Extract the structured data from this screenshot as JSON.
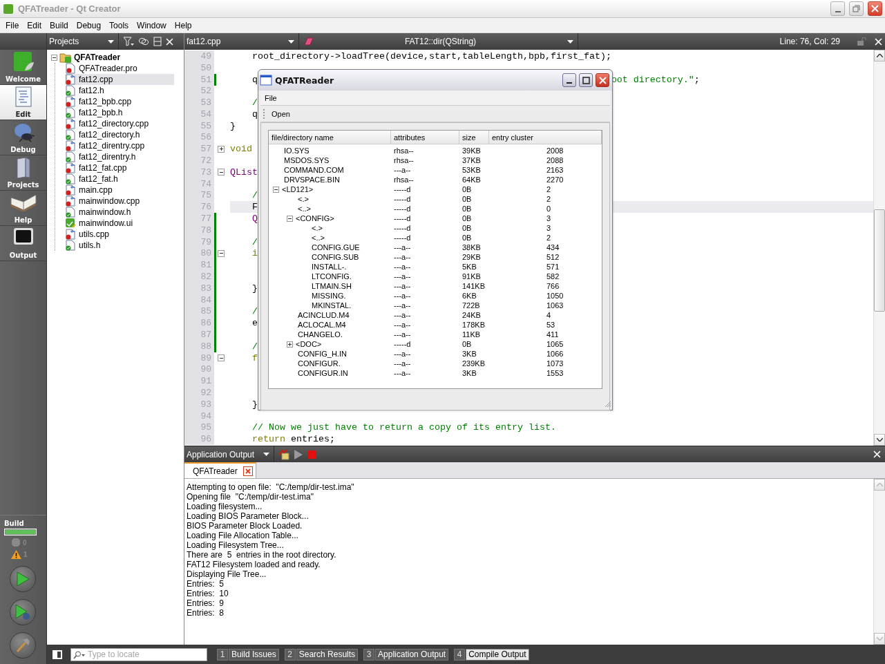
{
  "window": {
    "title": "QFATreader - Qt Creator"
  },
  "menu": [
    "File",
    "Edit",
    "Build",
    "Debug",
    "Tools",
    "Window",
    "Help"
  ],
  "modes": [
    {
      "label": "Welcome",
      "kind": "welcome",
      "selected": false
    },
    {
      "label": "Edit",
      "kind": "edit",
      "selected": true
    },
    {
      "label": "Debug",
      "kind": "debug",
      "selected": false
    },
    {
      "label": "Projects",
      "kind": "projects",
      "selected": false
    },
    {
      "label": "Help",
      "kind": "help",
      "selected": false
    },
    {
      "label": "Output",
      "kind": "output",
      "selected": false
    }
  ],
  "build": {
    "title": "Build",
    "level": 1,
    "errors": "0",
    "warnings": "1"
  },
  "projects": {
    "title": "Projects",
    "root": {
      "name": "QFATreader",
      "expanded": true,
      "children": [
        {
          "name": "QFATreader.pro",
          "kind": "pro",
          "selected": false
        },
        {
          "name": "fat12.cpp",
          "kind": "cpp",
          "selected": true
        },
        {
          "name": "fat12.h",
          "kind": "h",
          "selected": false
        },
        {
          "name": "fat12_bpb.cpp",
          "kind": "cpp",
          "selected": false
        },
        {
          "name": "fat12_bpb.h",
          "kind": "h",
          "selected": false
        },
        {
          "name": "fat12_directory.cpp",
          "kind": "cpp",
          "selected": false
        },
        {
          "name": "fat12_directory.h",
          "kind": "h",
          "selected": false
        },
        {
          "name": "fat12_direntry.cpp",
          "kind": "cpp",
          "selected": false
        },
        {
          "name": "fat12_direntry.h",
          "kind": "h",
          "selected": false
        },
        {
          "name": "fat12_fat.cpp",
          "kind": "cpp",
          "selected": false
        },
        {
          "name": "fat12_fat.h",
          "kind": "h",
          "selected": false
        },
        {
          "name": "main.cpp",
          "kind": "cpp",
          "selected": false
        },
        {
          "name": "mainwindow.cpp",
          "kind": "cpp",
          "selected": false
        },
        {
          "name": "mainwindow.h",
          "kind": "h",
          "selected": false
        },
        {
          "name": "mainwindow.ui",
          "kind": "ui",
          "selected": false
        },
        {
          "name": "utils.cpp",
          "kind": "cpp",
          "selected": false
        },
        {
          "name": "utils.h",
          "kind": "h",
          "selected": false
        }
      ]
    }
  },
  "editor": {
    "file": "fat12.cpp",
    "symbol": "FAT12::dir(QString)",
    "position": "Line: 76, Col: 29",
    "lines": [
      {
        "number": "49",
        "segments": [
          {
            "text": "    root_directory->loadTree(device,start,tableLength,bpb,first_fat);",
            "kind": "plain"
          }
        ],
        "changed": false,
        "current": false
      },
      {
        "number": "50",
        "changed": false,
        "current": false
      },
      {
        "number": "51",
        "segments": [
          {
            "text": "    q",
            "kind": "plain"
          }
        ],
        "tail": [
          {
            "text": "oot directory.\"",
            "kind": "string"
          },
          {
            "text": ";",
            "kind": "plain"
          }
        ],
        "changed": true,
        "current": false
      },
      {
        "number": "52",
        "changed": false,
        "current": false
      },
      {
        "number": "53",
        "segments": [
          {
            "text": "    /",
            "kind": "comment"
          }
        ],
        "changed": false,
        "current": false
      },
      {
        "number": "54",
        "segments": [
          {
            "text": "    q",
            "kind": "plain"
          }
        ],
        "changed": false,
        "current": false
      },
      {
        "number": "55",
        "segments": [
          {
            "text": "}",
            "kind": "plain"
          }
        ],
        "changed": false,
        "current": false
      },
      {
        "number": "56",
        "changed": false,
        "current": false
      },
      {
        "number": "57",
        "segments": [
          {
            "text": "void",
            "kind": "keyword"
          }
        ],
        "collapsed": true,
        "changed": false,
        "current": false
      },
      {
        "number": "72",
        "changed": false,
        "current": false
      },
      {
        "number": "73",
        "segments": [
          {
            "text": "QList",
            "kind": "type"
          }
        ],
        "collapsed": false,
        "changed": false,
        "current": false
      },
      {
        "number": "74",
        "changed": false,
        "current": false
      },
      {
        "number": "75",
        "segments": [
          {
            "text": "    /",
            "kind": "comment"
          }
        ],
        "changed": false,
        "current": false
      },
      {
        "number": "76",
        "segments": [
          {
            "text": "    F",
            "kind": "plain"
          }
        ],
        "changed": false,
        "current": true
      },
      {
        "number": "77",
        "segments": [
          {
            "text": "    Q",
            "kind": "type"
          }
        ],
        "changed": true,
        "current": false
      },
      {
        "number": "78",
        "changed": true,
        "current": false
      },
      {
        "number": "79",
        "segments": [
          {
            "text": "    /",
            "kind": "comment"
          }
        ],
        "changed": true,
        "current": false
      },
      {
        "number": "80",
        "segments": [
          {
            "text": "    i",
            "kind": "keyword"
          }
        ],
        "collapsed": false,
        "changed": true,
        "current": false
      },
      {
        "number": "81",
        "changed": true,
        "current": false
      },
      {
        "number": "82",
        "changed": true,
        "current": false
      },
      {
        "number": "83",
        "segments": [
          {
            "text": "    }",
            "kind": "plain"
          }
        ],
        "changed": true,
        "current": false
      },
      {
        "number": "84",
        "changed": true,
        "current": false
      },
      {
        "number": "85",
        "segments": [
          {
            "text": "    /",
            "kind": "comment"
          }
        ],
        "changed": true,
        "current": false
      },
      {
        "number": "86",
        "segments": [
          {
            "text": "    e",
            "kind": "plain"
          }
        ],
        "changed": true,
        "current": false
      },
      {
        "number": "87",
        "changed": true,
        "current": false
      },
      {
        "number": "88",
        "segments": [
          {
            "text": "    /",
            "kind": "comment"
          }
        ],
        "changed": true,
        "current": false
      },
      {
        "number": "89",
        "segments": [
          {
            "text": "    f",
            "kind": "keyword"
          }
        ],
        "collapsed": false,
        "changed": false,
        "current": false
      },
      {
        "number": "90",
        "changed": false,
        "current": false
      },
      {
        "number": "91",
        "changed": false,
        "current": false
      },
      {
        "number": "92",
        "changed": false,
        "current": false
      },
      {
        "number": "93",
        "segments": [
          {
            "text": "    }",
            "kind": "plain"
          }
        ],
        "changed": false,
        "current": false
      },
      {
        "number": "94",
        "changed": false,
        "current": false
      },
      {
        "number": "95",
        "segments": [
          {
            "text": "    // Now we just have to return a copy of its entry list.",
            "kind": "comment"
          }
        ],
        "changed": false,
        "current": false
      },
      {
        "number": "96",
        "segments": [
          {
            "text": "    return",
            "kind": "keyword"
          },
          {
            "text": " entries;",
            "kind": "plain"
          }
        ],
        "changed": false,
        "current": false
      }
    ]
  },
  "dialog": {
    "title": "QFATReader",
    "menu": [
      "File"
    ],
    "toolbar": [
      "Open"
    ],
    "columns": [
      "file/directory name",
      "attributes",
      "size",
      "entry cluster"
    ],
    "rows": [
      {
        "name": "IO.SYS",
        "attributes": "rhsa--",
        "size": "39KB",
        "cluster": "2008"
      },
      {
        "name": "MSDOS.SYS",
        "attributes": "rhsa--",
        "size": "37KB",
        "cluster": "2088"
      },
      {
        "name": "COMMAND.COM",
        "attributes": "---a--",
        "size": "53KB",
        "cluster": "2163"
      },
      {
        "name": "DRVSPACE.BIN",
        "attributes": "rhsa--",
        "size": "64KB",
        "cluster": "2270"
      },
      {
        "name": "<LD121>",
        "attributes": "-----d",
        "size": "0B",
        "cluster": "2",
        "expanded": true,
        "children": [
          {
            "name": "<.>",
            "attributes": "-----d",
            "size": "0B",
            "cluster": "2"
          },
          {
            "name": "<..>",
            "attributes": "-----d",
            "size": "0B",
            "cluster": "0"
          },
          {
            "name": "<CONFIG>",
            "attributes": "-----d",
            "size": "0B",
            "cluster": "3",
            "expanded": true,
            "children": [
              {
                "name": "<.>",
                "attributes": "-----d",
                "size": "0B",
                "cluster": "3"
              },
              {
                "name": "<..>",
                "attributes": "-----d",
                "size": "0B",
                "cluster": "2"
              },
              {
                "name": "CONFIG.GUE",
                "attributes": "---a--",
                "size": "38KB",
                "cluster": "434"
              },
              {
                "name": "CONFIG.SUB",
                "attributes": "---a--",
                "size": "29KB",
                "cluster": "512"
              },
              {
                "name": "INSTALL-.",
                "attributes": "---a--",
                "size": "5KB",
                "cluster": "571"
              },
              {
                "name": "LTCONFIG.",
                "attributes": "---a--",
                "size": "91KB",
                "cluster": "582"
              },
              {
                "name": "LTMAIN.SH",
                "attributes": "---a--",
                "size": "141KB",
                "cluster": "766"
              },
              {
                "name": "MISSING.",
                "attributes": "---a--",
                "size": "6KB",
                "cluster": "1050"
              },
              {
                "name": "MKINSTAL.",
                "attributes": "---a--",
                "size": "722B",
                "cluster": "1063"
              }
            ]
          },
          {
            "name": "ACINCLUD.M4",
            "attributes": "---a--",
            "size": "24KB",
            "cluster": "4"
          },
          {
            "name": "ACLOCAL.M4",
            "attributes": "---a--",
            "size": "178KB",
            "cluster": "53"
          },
          {
            "name": "CHANGELO.",
            "attributes": "---a--",
            "size": "11KB",
            "cluster": "411"
          },
          {
            "name": "<DOC>",
            "attributes": "-----d",
            "size": "0B",
            "cluster": "1065",
            "expanded": false
          },
          {
            "name": "CONFIG_H.IN",
            "attributes": "---a--",
            "size": "3KB",
            "cluster": "1066"
          },
          {
            "name": "CONFIGUR.",
            "attributes": "---a--",
            "size": "239KB",
            "cluster": "1073"
          },
          {
            "name": "CONFIGUR.IN",
            "attributes": "---a--",
            "size": "3KB",
            "cluster": "1553"
          }
        ]
      }
    ]
  },
  "output": {
    "title": "Application Output",
    "tab": "QFATreader",
    "lines": [
      "Attempting to open file:  \"C:/temp/dir-test.ima\"",
      "Opening file  \"C:/temp/dir-test.ima\"",
      "Loading filesystem...",
      "Loading BIOS Parameter Block...",
      "BIOS Parameter Block Loaded.",
      "Loading File Allocation Table...",
      "Loading Filesystem Tree...",
      "There are  5  entries in the root directory.",
      "FAT12 Filesystem loaded and ready.",
      "Displaying File Tree...",
      "Entries:  5",
      "Entries:  10",
      "Entries:  9",
      "Entries:  8"
    ]
  },
  "locate": {
    "placeholder": "Type to locate"
  },
  "panes": [
    {
      "number": "1",
      "label": "Build Issues",
      "selected": false
    },
    {
      "number": "2",
      "label": "Search Results",
      "selected": false
    },
    {
      "number": "3",
      "label": "Application Output",
      "selected": false
    },
    {
      "number": "4",
      "label": "Compile Output",
      "selected": true
    }
  ]
}
